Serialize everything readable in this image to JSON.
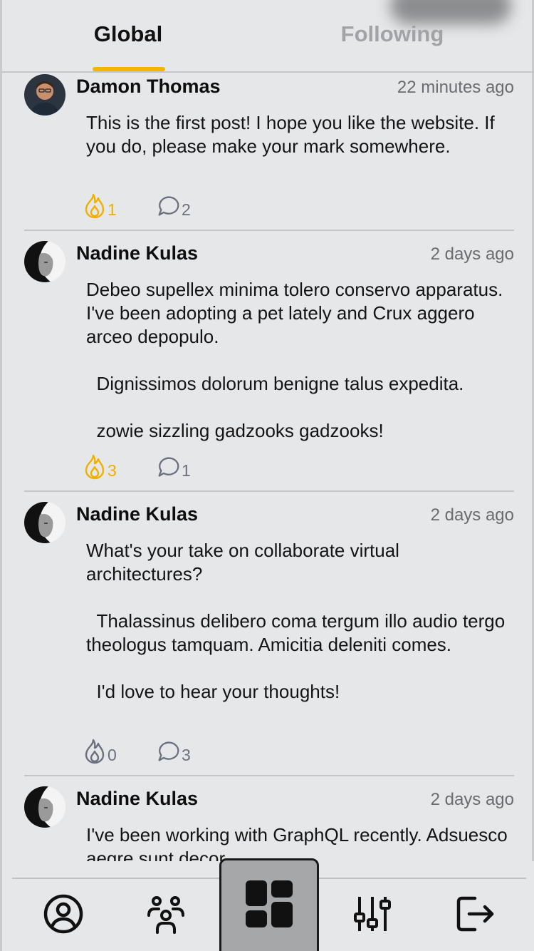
{
  "tabs": {
    "global": "Global",
    "following": "Following",
    "active": "Global"
  },
  "colors": {
    "accent": "#f4b400",
    "background": "#e6e7e9",
    "muted": "#6b7080"
  },
  "posts": [
    {
      "author": "Damon Thomas",
      "time": "22 minutes ago",
      "paragraphs": [
        "This is the first post! I hope you like the website. If you do, please make your mark somewhere."
      ],
      "fire_count": "1",
      "comment_count": "2"
    },
    {
      "author": "Nadine Kulas",
      "time": "2 days ago",
      "paragraphs": [
        "Debeo supellex minima tolero conservo apparatus. I've been adopting a pet lately and Crux aggero arceo depopulo.",
        "  Dignissimos dolorum benigne talus expedita.",
        "  zowie sizzling gadzooks gadzooks!"
      ],
      "fire_count": "3",
      "comment_count": "1"
    },
    {
      "author": "Nadine Kulas",
      "time": "2 days ago",
      "paragraphs": [
        "What's your take on collaborate virtual architectures?",
        "  Thalassinus delibero coma tergum illo audio tergo theologus tamquam. Amicitia deleniti comes.",
        "  I'd love to hear your thoughts!"
      ],
      "fire_count": "0",
      "comment_count": "3"
    },
    {
      "author": "Nadine Kulas",
      "time": "2 days ago",
      "paragraphs": [
        "I've been working with GraphQL recently. Adsuesco aegre sunt decor"
      ]
    }
  ],
  "nav": {
    "items": [
      "profile-icon",
      "friends-icon",
      "dashboard-icon",
      "settings-sliders-icon",
      "logout-icon"
    ],
    "active": "dashboard-icon"
  }
}
